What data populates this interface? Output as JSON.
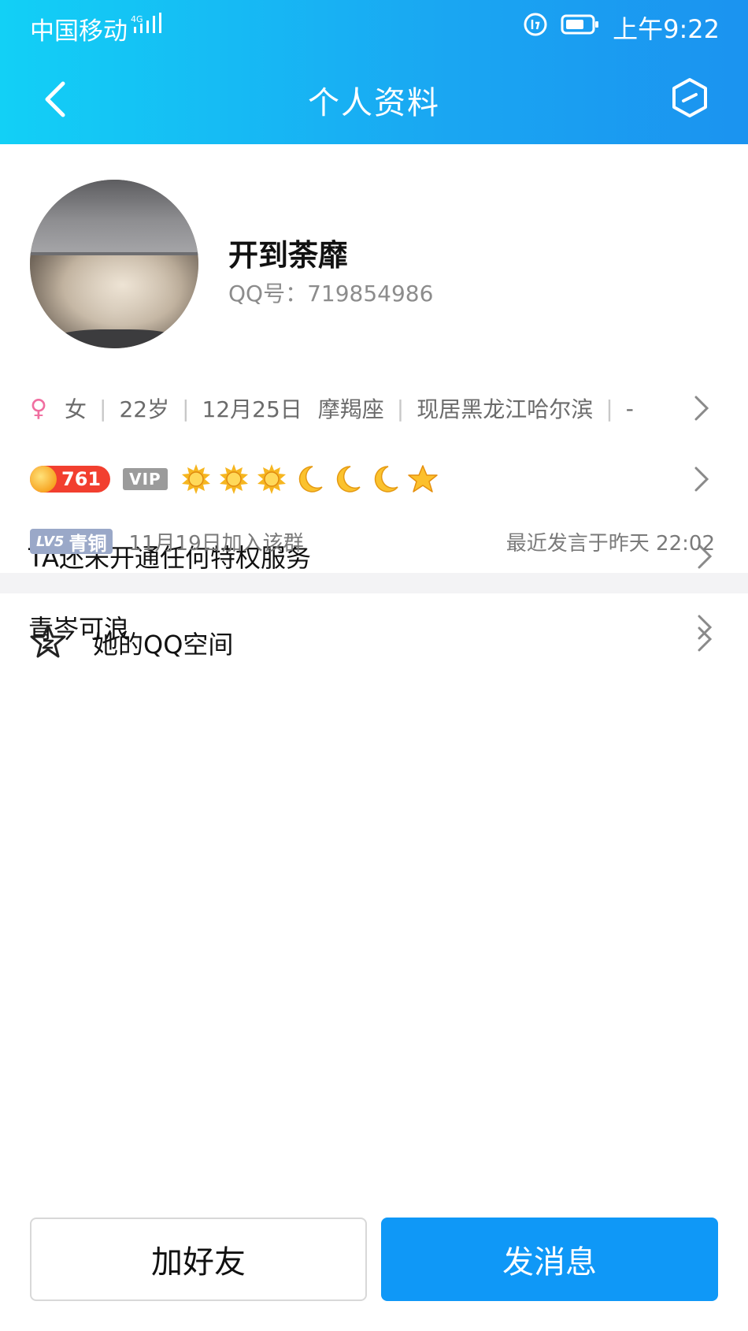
{
  "status_bar": {
    "carrier": "中国移动",
    "network": "4G",
    "time": "上午9:22"
  },
  "navbar": {
    "title": "个人资料"
  },
  "profile": {
    "name": "开到荼靡",
    "qq_label": "QQ号：719854986"
  },
  "info": {
    "gender": "女",
    "age": "22岁",
    "birthday": "12月25日",
    "zodiac": "摩羯座",
    "location": "现居黑龙江哈尔滨",
    "extra": "-"
  },
  "vip": {
    "coins": "761",
    "vip_tag": "VIP",
    "level_icons": [
      "sun-icon",
      "sun-icon",
      "sun-icon",
      "moon-icon",
      "moon-icon",
      "moon-icon",
      "star-icon"
    ]
  },
  "privilege": {
    "text": "TA还未开通任何特权服务"
  },
  "group": {
    "nickname": "青岑可浪",
    "level_code": "LV5",
    "level_name": "青铜",
    "joined": "11月19日加入该群",
    "last_spoke": "最近发言于昨天 22:02"
  },
  "space": {
    "label": "她的QQ空间"
  },
  "buttons": {
    "add_friend": "加好友",
    "send_message": "发消息"
  },
  "colors": {
    "header_gradient_start": "#12d0f6",
    "header_gradient_end": "#1b93f0",
    "primary_button": "#0f98f7"
  }
}
